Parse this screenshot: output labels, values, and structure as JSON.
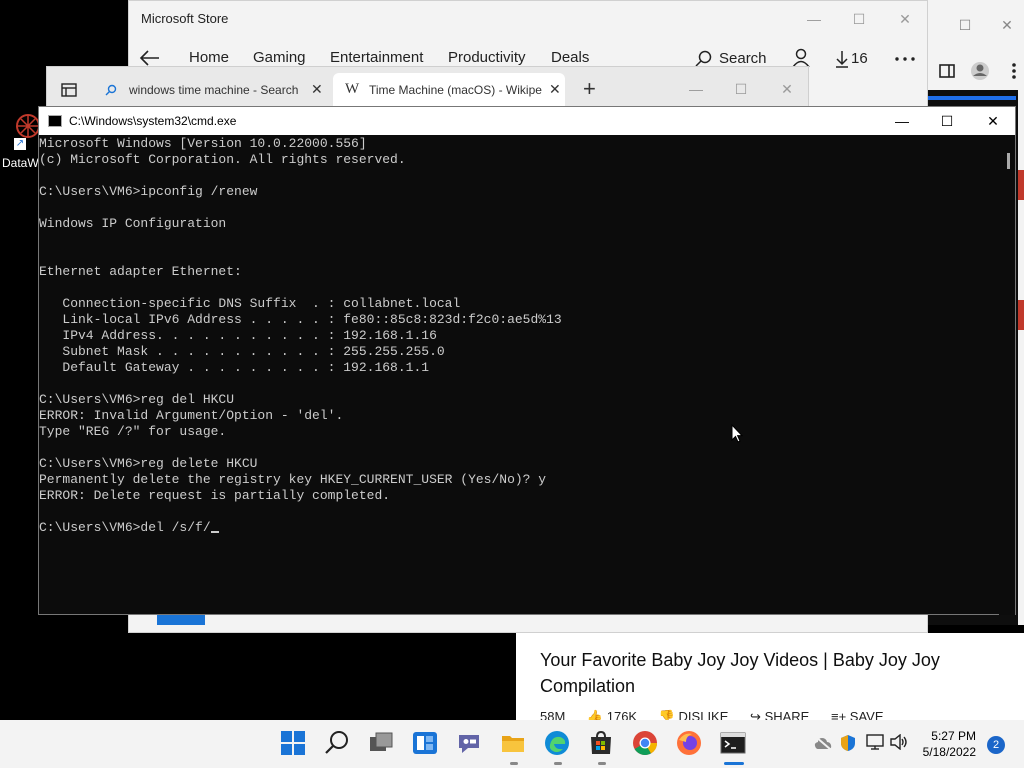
{
  "desktop": {
    "icon_label": "DataW"
  },
  "store": {
    "title": "Microsoft Store",
    "nav": [
      "Home",
      "Gaming",
      "Entertainment",
      "Productivity",
      "Deals"
    ],
    "search_label": "Search",
    "downloads_count": "16"
  },
  "edge": {
    "tabs": [
      {
        "label": "windows time machine - Search"
      },
      {
        "label": "Time Machine (macOS) - Wikipe"
      }
    ]
  },
  "youtube": {
    "title": "Your Favorite Baby Joy Joy Videos | Baby Joy Joy Compilation",
    "views": "58M",
    "likes": "176K",
    "dislike": "DISLIKE",
    "share": "SHARE",
    "save": "SAVE"
  },
  "cmd": {
    "title": "C:\\Windows\\system32\\cmd.exe",
    "lines": [
      "Microsoft Windows [Version 10.0.22000.556]",
      "(c) Microsoft Corporation. All rights reserved.",
      "",
      "C:\\Users\\VM6>ipconfig /renew",
      "",
      "Windows IP Configuration",
      "",
      "",
      "Ethernet adapter Ethernet:",
      "",
      "   Connection-specific DNS Suffix  . : collabnet.local",
      "   Link-local IPv6 Address . . . . . : fe80::85c8:823d:f2c0:ae5d%13",
      "   IPv4 Address. . . . . . . . . . . : 192.168.1.16",
      "   Subnet Mask . . . . . . . . . . . : 255.255.255.0",
      "   Default Gateway . . . . . . . . . : 192.168.1.1",
      "",
      "C:\\Users\\VM6>reg del HKCU",
      "ERROR: Invalid Argument/Option - 'del'.",
      "Type \"REG /?\" for usage.",
      "",
      "C:\\Users\\VM6>reg delete HKCU",
      "Permanently delete the registry key HKEY_CURRENT_USER (Yes/No)? y",
      "ERROR: Delete request is partially completed.",
      "",
      "C:\\Users\\VM6>del /s/f/"
    ]
  },
  "taskbar": {
    "time": "5:27 PM",
    "date": "5/18/2022",
    "notifications": "2"
  },
  "colors": {
    "accent": "#1a74d6",
    "console_bg": "#0c0c0c",
    "console_fg": "#cccccc",
    "taskbar_bg": "#f3f3f3"
  }
}
